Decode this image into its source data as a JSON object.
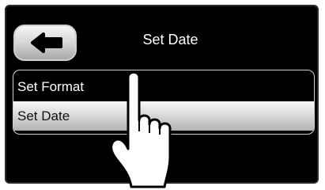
{
  "header": {
    "title": "Set Date",
    "back_icon": "back-arrow-icon"
  },
  "menu": {
    "items": [
      {
        "label": "Set Format",
        "selected": false
      },
      {
        "label": "Set Date",
        "selected": true
      }
    ]
  },
  "overlay": {
    "icon": "pointing-hand-icon"
  },
  "colors": {
    "screen_background": "#000000",
    "text_on_dark": "#ffffff",
    "selected_row": "#d9d9d9"
  }
}
